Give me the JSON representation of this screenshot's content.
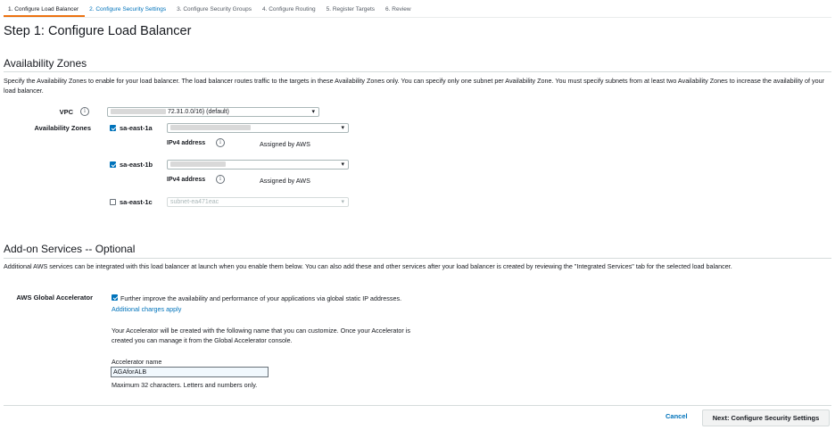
{
  "tabs": [
    {
      "label": "1. Configure Load Balancer"
    },
    {
      "label": "2. Configure Security Settings"
    },
    {
      "label": "3. Configure Security Groups"
    },
    {
      "label": "4. Configure Routing"
    },
    {
      "label": "5. Register Targets"
    },
    {
      "label": "6. Review"
    }
  ],
  "step_title": "Step 1: Configure Load Balancer",
  "availability": {
    "heading": "Availability Zones",
    "description": "Specify the Availability Zones to enable for your load balancer. The load balancer routes traffic to the targets in these Availability Zones only. You can specify only one subnet per Availability Zone. You must specify subnets from at least two Availability Zones to increase the availability of your load balancer.",
    "vpc_label": "VPC",
    "vpc_value": "72.31.0.0/16) (default)",
    "az_label": "Availability Zones",
    "zones": [
      {
        "name": "sa-east-1a",
        "checked": true,
        "ipv4_label": "IPv4 address",
        "ipv4_value": "Assigned by AWS"
      },
      {
        "name": "sa-east-1b",
        "checked": true,
        "ipv4_label": "IPv4 address",
        "ipv4_value": "Assigned by AWS"
      },
      {
        "name": "sa-east-1c",
        "checked": false,
        "subnet": "subnet-ea471eac"
      }
    ]
  },
  "addons": {
    "heading": "Add-on Services -- Optional",
    "description": "Additional AWS services can be integrated with this load balancer at launch when you enable them below. You can also add these and other services after your load balancer is created by reviewing the \"Integrated Services\" tab for the selected load balancer.",
    "accelerator_label": "AWS Global Accelerator",
    "accelerator_checkbox_text": "Further improve the availability and performance of your applications via global static IP addresses.",
    "charges_link": "Additional charges apply",
    "info_line1": "Your Accelerator will be created with the following name that you can customize. Once your Accelerator is",
    "info_line2": "created you can manage it from the Global Accelerator console.",
    "name_label": "Accelerator name",
    "name_value": "AGAforALB",
    "name_hint": "Maximum 32 characters. Letters and numbers only."
  },
  "footer": {
    "cancel": "Cancel",
    "next": "Next: Configure Security Settings"
  },
  "colors": {
    "accent_orange": "#ec7211",
    "link_blue": "#0073bb"
  },
  "icons": {
    "info": "info-icon",
    "dropdown": "select-caret-icon",
    "checkbox": "checkbox"
  }
}
